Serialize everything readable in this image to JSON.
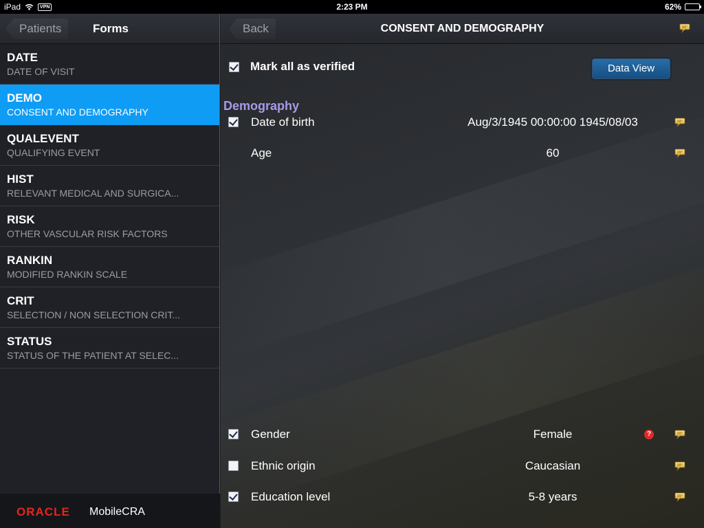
{
  "status_bar": {
    "device": "iPad",
    "vpn_label": "VPN",
    "time": "2:23 PM",
    "battery_text": "62%",
    "battery_level": 0.62
  },
  "left_nav": {
    "back_label": "Patients",
    "title": "Forms"
  },
  "forms": [
    {
      "code": "DATE",
      "desc": "DATE OF VISIT",
      "selected": false
    },
    {
      "code": "DEMO",
      "desc": "CONSENT AND DEMOGRAPHY",
      "selected": true
    },
    {
      "code": "QUALEVENT",
      "desc": "QUALIFYING EVENT",
      "selected": false
    },
    {
      "code": "HIST",
      "desc": "RELEVANT MEDICAL AND SURGICA...",
      "selected": false
    },
    {
      "code": "RISK",
      "desc": "OTHER VASCULAR RISK FACTORS",
      "selected": false
    },
    {
      "code": "RANKIN",
      "desc": "MODIFIED RANKIN SCALE",
      "selected": false
    },
    {
      "code": "CRIT",
      "desc": "SELECTION / NON SELECTION CRIT...",
      "selected": false
    },
    {
      "code": "STATUS",
      "desc": "STATUS OF THE PATIENT AT SELEC...",
      "selected": false
    }
  ],
  "brand": {
    "oracle": "ORACLE",
    "product": "MobileCRA"
  },
  "right_nav": {
    "back_label": "Back",
    "title": "CONSENT AND DEMOGRAPHY",
    "note_icon": "note-icon"
  },
  "verify": {
    "label": "Mark all as verified",
    "checked": true
  },
  "data_view_button": "Data View",
  "section": {
    "title": "Demography"
  },
  "fields": [
    {
      "label": "Date of birth",
      "value": "Aug/3/1945 00:00:00 1945/08/03",
      "checkbox": "checked",
      "query": false
    },
    {
      "label": "Age",
      "value": "60",
      "checkbox": "none",
      "query": false
    },
    {
      "label": "Gender",
      "value": "Female",
      "checkbox": "checked",
      "query": true,
      "query_symbol": "?"
    },
    {
      "label": "Ethnic origin",
      "value": "Caucasian",
      "checkbox": "unchecked",
      "query": false
    },
    {
      "label": "Education level",
      "value": "5-8 years",
      "checkbox": "checked",
      "query": false
    }
  ],
  "colors": {
    "selected_row": "#0f9cf5",
    "section_title": "#a79ae8",
    "oracle_red": "#e0271e",
    "button_blue": "#1e5f96"
  }
}
